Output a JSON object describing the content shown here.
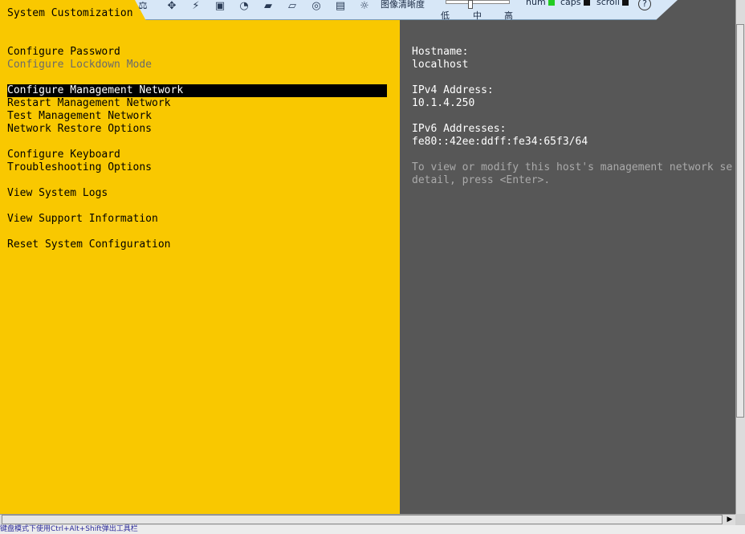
{
  "console": {
    "title": "System Customization",
    "menu": [
      {
        "label": "Configure Password",
        "state": "normal"
      },
      {
        "label": "Configure Lockdown Mode",
        "state": "disabled"
      },
      {
        "label": "Configure Management Network",
        "state": "selected"
      },
      {
        "label": "Restart Management Network",
        "state": "normal"
      },
      {
        "label": "Test Management Network",
        "state": "normal"
      },
      {
        "label": "Network Restore Options",
        "state": "normal"
      },
      {
        "label": "Configure Keyboard",
        "state": "normal"
      },
      {
        "label": "Troubleshooting Options",
        "state": "normal"
      },
      {
        "label": "View System Logs",
        "state": "normal"
      },
      {
        "label": "View Support Information",
        "state": "normal"
      },
      {
        "label": "Reset System Configuration",
        "state": "normal"
      }
    ],
    "info": {
      "hostname_label": "Hostname:",
      "hostname": "localhost",
      "ipv4_label": "IPv4 Address:",
      "ipv4": "10.1.4.250",
      "ipv6_label": "IPv6 Addresses:",
      "ipv6": "fe80::42ee:ddff:fe34:65f3/64",
      "hint_line1": "To view or modify this host's management network se",
      "hint_line2": "detail, press <Enter>."
    }
  },
  "toolbar": {
    "image_quality_label": "图像清晰度",
    "quality_low": "低",
    "quality_mid": "中",
    "quality_high": "高",
    "num_label": "num",
    "caps_label": "caps",
    "scroll_label": "scroll",
    "help_symbol": "?",
    "led_colors": {
      "num": "#22cc22",
      "caps": "#111111",
      "scroll": "#111111"
    }
  },
  "status": {
    "text": "键盘模式下使用Ctrl+Alt+Shift弹出工具栏"
  },
  "colors": {
    "console_yellow": "#f9c800",
    "console_gray": "#575757"
  }
}
